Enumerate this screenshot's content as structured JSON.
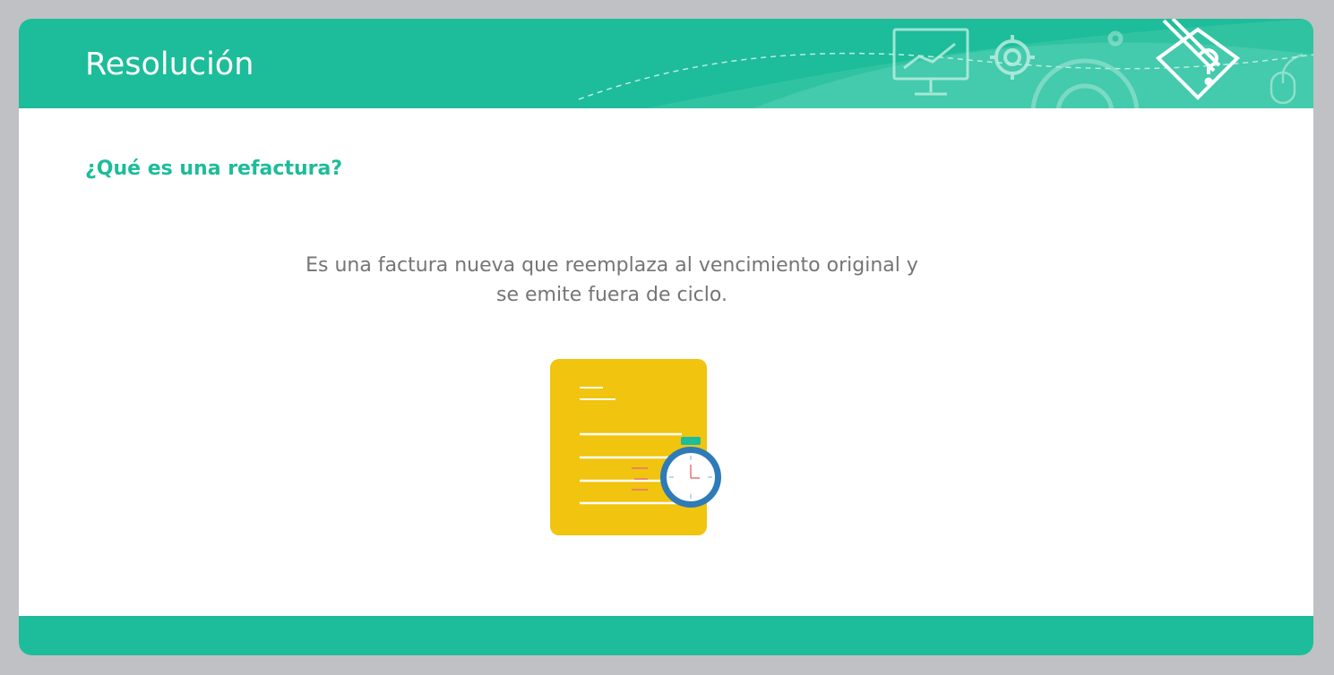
{
  "header": {
    "title": "Resolución",
    "icons": [
      "monitor-chart-icon",
      "gear-icon",
      "large-gear-icon",
      "pencil-question-icon",
      "mouse-icon"
    ]
  },
  "content": {
    "question": "¿Qué es una refactura?",
    "answer": "Es una factura nueva que reemplaza al vencimiento original y se emite fuera de ciclo.",
    "illustration": "document-stopwatch-icon"
  },
  "colors": {
    "accent": "#1dbc9a",
    "background": "#bfc1c4",
    "card": "#ffffff",
    "body_text": "#757575",
    "document": "#f0c40f",
    "stopwatch_ring": "#2e7bb8"
  }
}
